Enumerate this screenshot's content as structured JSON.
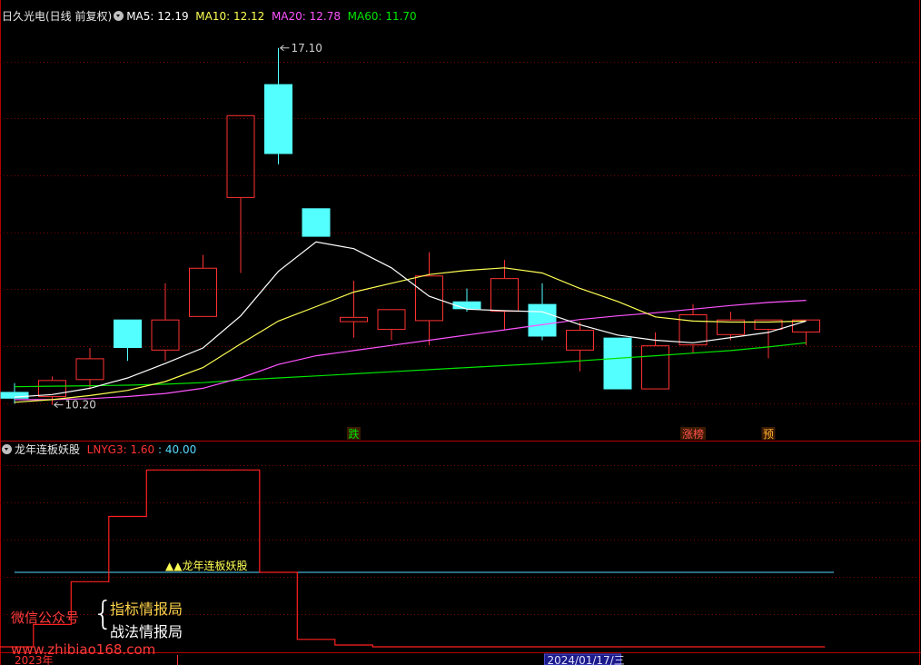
{
  "main_header": {
    "stock": "日久光电(日线 前复权)",
    "ma5": "MA5: 12.19",
    "ma10": "MA10: 12.12",
    "ma20": "MA20: 12.78",
    "ma60": "MA60: 11.70"
  },
  "sub_header": {
    "indicator": "龙年连板妖股",
    "lnyg3": "LNYG3: 1.60",
    "value": ": 40.00"
  },
  "watermark": {
    "wechat": "微信公众号",
    "brace": "{",
    "line1": "指标情报局",
    "line2": "战法情报局",
    "url": "www.zhibiao168.com"
  },
  "colors": {
    "up": "#ff3232",
    "down": "#54ffff",
    "ma5": "#ffffff",
    "ma10": "#ffff54",
    "ma20": "#ff54ff",
    "ma60": "#00e600",
    "lnyg": "#ff2020",
    "ref_line": "#54d8ff",
    "gold": "#ffd24a"
  },
  "chart_data": {
    "type": "candlestick",
    "candles": [
      {
        "o": 10.45,
        "h": 10.62,
        "l": 10.22,
        "c": 10.32
      },
      {
        "o": 10.35,
        "h": 10.75,
        "l": 10.2,
        "c": 10.68
      },
      {
        "o": 10.68,
        "h": 11.3,
        "l": 10.5,
        "c": 11.1
      },
      {
        "o": 11.85,
        "h": 11.85,
        "l": 11.05,
        "c": 11.3
      },
      {
        "o": 11.25,
        "h": 12.55,
        "l": 11.05,
        "c": 11.85
      },
      {
        "o": 11.9,
        "h": 13.1,
        "l": 11.9,
        "c": 12.85
      },
      {
        "o": 14.2,
        "h": 14.25,
        "l": 12.75,
        "c": 15.8
      },
      {
        "o": 16.4,
        "h": 17.1,
        "l": 14.85,
        "c": 15.05
      },
      {
        "o": 14.0,
        "h": 14.0,
        "l": 13.45,
        "c": 13.45
      },
      {
        "o": 11.8,
        "h": 12.6,
        "l": 11.5,
        "c": 11.9
      },
      {
        "o": 11.65,
        "h": 12.05,
        "l": 11.45,
        "c": 12.05
      },
      {
        "o": 11.82,
        "h": 13.15,
        "l": 11.35,
        "c": 12.7
      },
      {
        "o": 12.2,
        "h": 12.45,
        "l": 12.0,
        "c": 12.05
      },
      {
        "o": 12.0,
        "h": 13.0,
        "l": 11.65,
        "c": 12.65
      },
      {
        "o": 12.15,
        "h": 12.55,
        "l": 11.45,
        "c": 11.52
      },
      {
        "o": 11.25,
        "h": 11.8,
        "l": 10.85,
        "c": 11.65
      },
      {
        "o": 11.5,
        "h": 11.5,
        "l": 10.5,
        "c": 10.5
      },
      {
        "o": 10.5,
        "h": 11.6,
        "l": 10.5,
        "c": 11.35
      },
      {
        "o": 11.35,
        "h": 12.15,
        "l": 11.2,
        "c": 11.95
      },
      {
        "o": 11.55,
        "h": 12.0,
        "l": 11.45,
        "c": 11.85
      },
      {
        "o": 11.65,
        "h": 11.8,
        "l": 11.1,
        "c": 11.85
      },
      {
        "o": 11.6,
        "h": 11.8,
        "l": 11.35,
        "c": 11.85
      }
    ],
    "ma5": [
      10.35,
      10.4,
      10.52,
      10.72,
      11.0,
      11.3,
      11.92,
      12.78,
      13.35,
      13.22,
      12.85,
      12.3,
      12.05,
      12.02,
      12.0,
      11.75,
      11.55,
      11.45,
      11.4,
      11.5,
      11.6,
      11.82
    ],
    "ma10": [
      10.25,
      10.3,
      10.38,
      10.48,
      10.65,
      10.92,
      11.38,
      11.82,
      12.1,
      12.38,
      12.55,
      12.72,
      12.8,
      12.85,
      12.75,
      12.45,
      12.2,
      11.9,
      11.82,
      11.8,
      11.8,
      11.82
    ],
    "ma20": [
      10.3,
      10.3,
      10.32,
      10.36,
      10.42,
      10.52,
      10.72,
      10.98,
      11.15,
      11.25,
      11.35,
      11.45,
      11.55,
      11.65,
      11.75,
      11.85,
      11.92,
      11.98,
      12.05,
      12.12,
      12.18,
      12.22
    ],
    "ma60": [
      10.55,
      10.56,
      10.57,
      10.58,
      10.6,
      10.63,
      10.68,
      10.72,
      10.76,
      10.8,
      10.84,
      10.88,
      10.92,
      10.96,
      11.0,
      11.05,
      11.1,
      11.15,
      11.2,
      11.25,
      11.32,
      11.4
    ],
    "ylim": [
      9.86,
      17.5
    ],
    "annotations": [
      {
        "label": "17.10",
        "index": 7,
        "price": 17.1,
        "side": "right"
      },
      {
        "label": "10.20",
        "index": 1,
        "price": 10.2,
        "side": "right"
      }
    ],
    "markers": [
      {
        "label": "跌",
        "index": 9,
        "color": "#00e600"
      },
      {
        "label": "涨榜",
        "index": 18,
        "color": "#ff5050"
      },
      {
        "label": "预",
        "index": 20,
        "color": "#ffb030"
      }
    ],
    "lnyg_line": [
      0,
      12,
      35,
      70,
      95,
      95,
      95,
      40,
      4,
      1,
      0,
      0,
      0,
      0,
      0,
      0,
      0,
      0,
      0,
      0,
      0,
      0
    ],
    "lnyg_ylim": [
      0,
      100
    ],
    "ref_value": 40,
    "ref_label": "▲▲龙年连板妖股",
    "date_left": "2023年",
    "date_box": "2024/01/17/三"
  }
}
